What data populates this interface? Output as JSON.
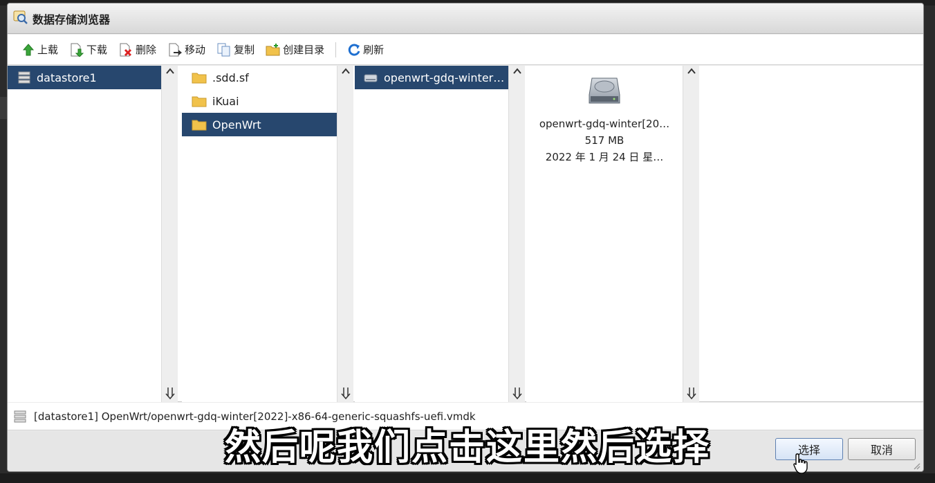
{
  "window": {
    "title": "数据存储浏览器"
  },
  "toolbar": {
    "upload": "上载",
    "download": "下载",
    "delete": "删除",
    "move": "移动",
    "copy": "复制",
    "mkdir": "创建目录",
    "refresh": "刷新"
  },
  "col1": {
    "items": [
      {
        "label": "datastore1",
        "selected": true
      }
    ]
  },
  "col2": {
    "items": [
      {
        "label": ".sdd.sf",
        "selected": false
      },
      {
        "label": "iKuai",
        "selected": false
      },
      {
        "label": "OpenWrt",
        "selected": true
      }
    ]
  },
  "col3": {
    "items": [
      {
        "label": "openwrt-gdq-winter…",
        "selected": true
      }
    ]
  },
  "details": {
    "name": "openwrt-gdq-winter[20…",
    "size": "517 MB",
    "date": "2022 年 1 月 24 日 星…"
  },
  "pathbar": {
    "path": "[datastore1] OpenWrt/openwrt-gdq-winter[2022]-x86-64-generic-squashfs-uefi.vmdk"
  },
  "buttons": {
    "select": "选择",
    "cancel": "取消"
  },
  "subtitle": "然后呢我们点击这里然后选择",
  "colors": {
    "selection": "#27476e",
    "folder": "#f1c24b"
  }
}
